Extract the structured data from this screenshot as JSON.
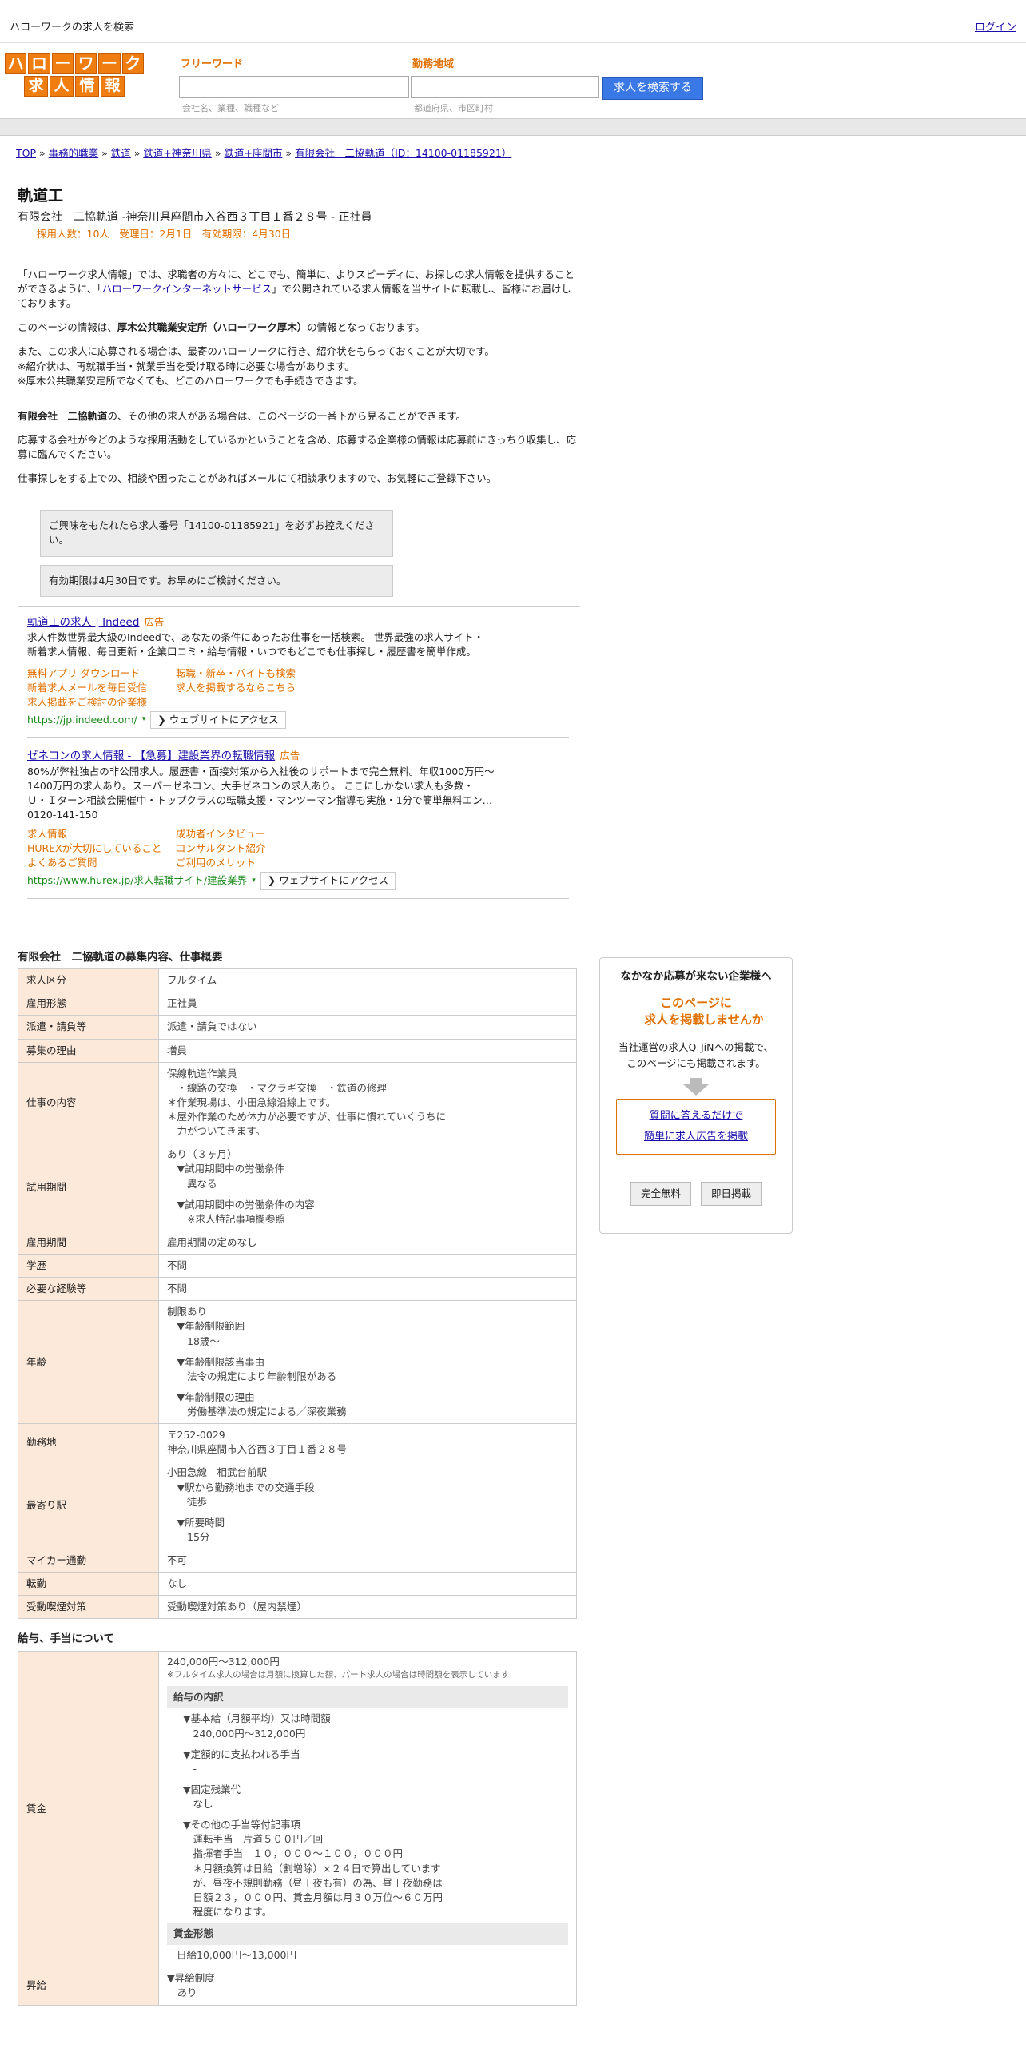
{
  "header": {
    "site_title": "ハローワークの求人を検索",
    "login": "ログイン",
    "logo_row1": [
      "ハ",
      "ロ",
      "ー",
      "ワ",
      "ー",
      "ク"
    ],
    "logo_row2": [
      "求",
      "人",
      "情",
      "報"
    ]
  },
  "search": {
    "freeword_label": "フリーワード",
    "freeword_placeholder": "会社名、業種、職種など",
    "area_label": "勤務地域",
    "area_placeholder": "都道府県、市区町村",
    "button": "求人を検索する"
  },
  "breadcrumb": [
    "TOP",
    "事務的職業",
    "鉄道",
    "鉄道+神奈川県",
    "鉄道+座間市",
    "有限会社　二協軌道（ID：14100-01185921）"
  ],
  "job": {
    "title": "軌道工",
    "company_line": "有限会社　二協軌道 -神奈川県座間市入谷西３丁目１番２８号 - 正社員",
    "meta": "採用人数：10人　受理日：2月1日　有効期限：4月30日"
  },
  "intro": {
    "p1a": "「ハローワーク求人情報」では、求職者の方々に、どこでも、簡単に、よりスピーディに、お探しの求人情報を提供することができるように、「",
    "p1_link": "ハローワークインターネットサービス",
    "p1b": "」で公開されている求人情報を当サイトに転載し、皆様にお届けしております。",
    "p2a": "このページの情報は、",
    "p2_bold": "厚木公共職業安定所（ハローワーク厚木）",
    "p2b": "の情報となっております。",
    "p3_1": "また、この求人に応募される場合は、最寄のハローワークに行き、紹介状をもらっておくことが大切です。",
    "p3_2": "※紹介状は、再就職手当・就業手当を受け取る時に必要な場合があります。",
    "p3_3": "※厚木公共職業安定所でなくても、どこのハローワークでも手続きできます。",
    "p4_bold": "有限会社　二協軌道",
    "p4b": "の、その他の求人がある場合は、このページの一番下から見ることができます。",
    "p5": "応募する会社が今どのような採用活動をしているかということを含め、応募する企業様の情報は応募前にきっちり収集し、応募に臨んでください。",
    "p6": "仕事探しをする上での、相談や困ったことがあればメールにて相談承りますので、お気軽にご登録下さい。"
  },
  "notices": [
    "ご興味をもたれたら求人番号「14100-01185921」を必ずお控えください。",
    "有効期限は4月30日です。お早めにご検討ください。"
  ],
  "ads": [
    {
      "title": "軌道工の求人 | Indeed",
      "badge": "広告",
      "desc": [
        "求人件数世界最大級のIndeedで、あなたの条件にあったお仕事を一括検索。 世界最強の求人サイト・",
        "新着求人情報、毎日更新・企業口コミ・給与情報・いつでもどこでも仕事探し・履歴書を簡単作成。"
      ],
      "links": [
        "無料アプリ ダウンロード",
        "転職・新卒・バイトも検索",
        "新着求人メールを毎日受信",
        "求人を掲載するならこちら",
        "求人掲載をご検討の企業様"
      ],
      "url": "https://jp.indeed.com/",
      "visit": "ウェブサイトにアクセス"
    },
    {
      "title": "ゼネコンの求人情報 - 【急募】建設業界の転職情報",
      "badge": "広告",
      "desc": [
        "80%が弊社独占の非公開求人。履歴書・面接対策から入社後のサポートまで完全無料。年収1000万円〜",
        "1400万円の求人あり。スーパーゼネコン、大手ゼネコンの求人あり。 ここにしかない求人も多数・",
        "Ｕ・Ｉターン相談会開催中・トップクラスの転職支援・マンツーマン指導も実施・1分で簡単無料エン…",
        "0120-141-150"
      ],
      "links": [
        "求人情報",
        "成功者インタビュー",
        "HUREXが大切にしていること",
        "コンサルタント紹介",
        "よくあるご質問",
        "ご利用のメリット"
      ],
      "url": "https://www.hurex.jp/求人転職サイト/建設業界",
      "visit": "ウェブサイトにアクセス"
    }
  ],
  "details": {
    "title": "有限会社　二協軌道の募集内容、仕事概要",
    "rows": [
      {
        "k": "求人区分",
        "v": [
          "フルタイム"
        ]
      },
      {
        "k": "雇用形態",
        "v": [
          "正社員"
        ]
      },
      {
        "k": "派遣・請負等",
        "v": [
          "派遣・請負ではない"
        ]
      },
      {
        "k": "募集の理由",
        "v": [
          "増員"
        ]
      },
      {
        "k": "仕事の内容",
        "v": [
          "保線軌道作業員",
          "　・線路の交換　・マクラギ交換　・鉄道の修理",
          "＊作業現場は、小田急線沿線上です。",
          "＊屋外作業のため体力が必要ですが、仕事に慣れていくうちに",
          "　力がついてきます。"
        ]
      },
      {
        "k": "試用期間",
        "v": [
          "あり（３ヶ月）",
          "　▼試用期間中の労働条件",
          "　　異なる",
          "",
          "　▼試用期間中の労働条件の内容",
          "　　※求人特記事項欄参照"
        ]
      },
      {
        "k": "雇用期間",
        "v": [
          "雇用期間の定めなし"
        ]
      },
      {
        "k": "学歴",
        "v": [
          "不問"
        ]
      },
      {
        "k": "必要な経験等",
        "v": [
          "不問"
        ]
      },
      {
        "k": "年齢",
        "v": [
          "制限あり",
          "　▼年齢制限範囲",
          "　　18歳〜",
          "",
          "　▼年齢制限該当事由",
          "　　法令の規定により年齢制限がある",
          "",
          "　▼年齢制限の理由",
          "　　労働基準法の規定による／深夜業務"
        ]
      },
      {
        "k": "勤務地",
        "v": [
          "〒252-0029",
          "神奈川県座間市入谷西３丁目１番２８号"
        ]
      },
      {
        "k": "最寄り駅",
        "v": [
          "小田急線　相武台前駅",
          "　▼駅から勤務地までの交通手段",
          "　　徒歩",
          "",
          "　▼所要時間",
          "　　15分"
        ]
      },
      {
        "k": "マイカー通勤",
        "v": [
          "不可"
        ]
      },
      {
        "k": "転勤",
        "v": [
          "なし"
        ]
      },
      {
        "k": "受動喫煙対策",
        "v": [
          "受動喫煙対策あり（屋内禁煙）"
        ]
      }
    ]
  },
  "salary": {
    "title": "給与、手当について",
    "key": "賃金",
    "range": "240,000円〜312,000円",
    "note": "※フルタイム求人の場合は月額に換算した額、パート求人の場合は時間額を表示しています",
    "breakdown_head": "給与の内訳",
    "breakdown": [
      "▼基本給（月額平均）又は時間額",
      "　240,000円〜312,000円",
      "",
      "▼定額的に支払われる手当",
      "　-",
      "",
      "▼固定残業代",
      "　なし",
      "",
      "▼その他の手当等付記事項",
      "　運転手当　片道５００円／回",
      "　指揮者手当　１０，０００〜１００，０００円",
      "　＊月額換算は日給（割増除）×２４日で算出しています",
      "　が、昼夜不規則勤務（昼＋夜も有）の為、昼＋夜勤務は",
      "　日額２３，０００円、賃金月額は月３０万位〜６０万円",
      "　程度になります。"
    ],
    "form_head": "賃金形態",
    "form": "日給10,000円〜13,000円",
    "raise_key": "昇給",
    "raise": [
      "▼昇給制度",
      "　あり"
    ]
  },
  "sidebar": {
    "heading": "なかなか応募が来ない企業様へ",
    "orange1": "このページに",
    "orange2": "求人を掲載しませんか",
    "text1": "当社運営の求人Q-JiNへの掲載で、",
    "text2": "このページにも掲載されます。",
    "link1": "質問に答えるだけで",
    "link2": "簡単に求人広告を掲載",
    "btn1": "完全無料",
    "btn2": "即日掲載"
  }
}
